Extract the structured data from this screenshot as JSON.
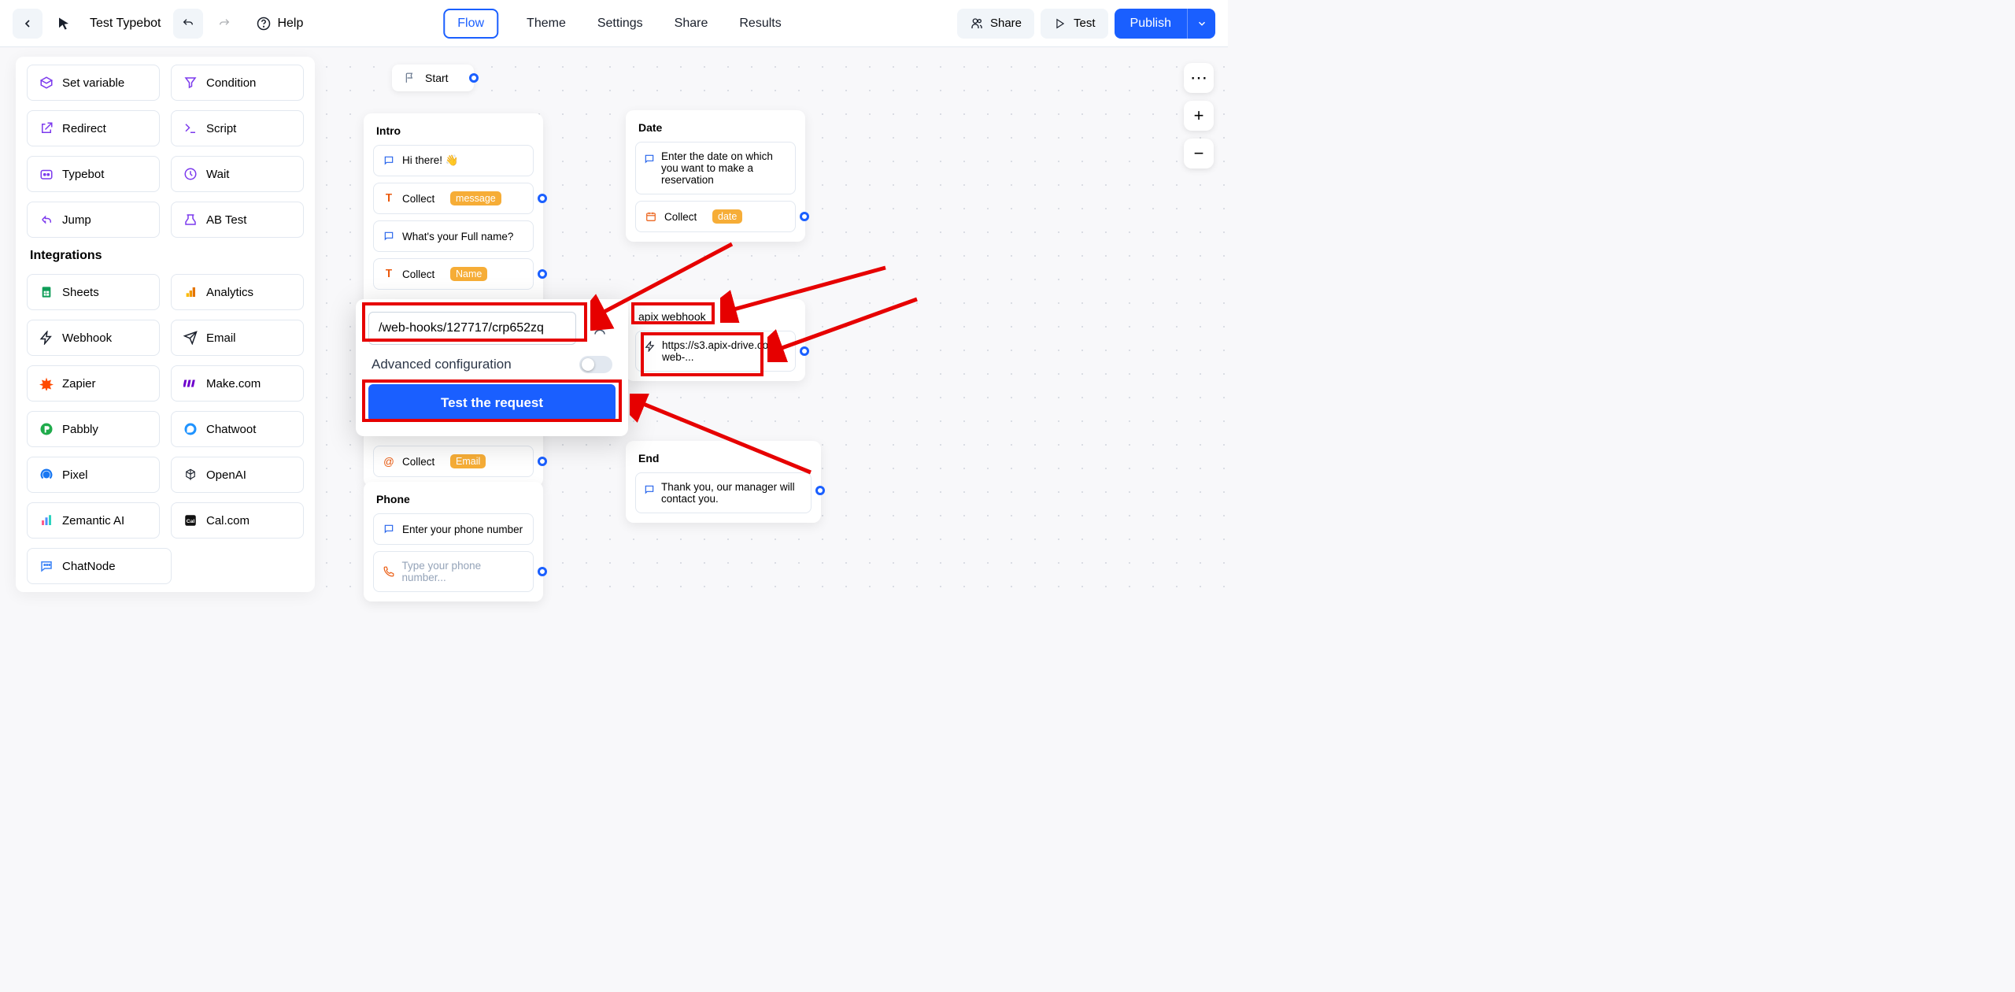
{
  "header": {
    "bot_name": "Test Typebot",
    "help": "Help",
    "tabs": {
      "flow": "Flow",
      "theme": "Theme",
      "settings": "Settings",
      "share": "Share",
      "results": "Results"
    },
    "share_btn": "Share",
    "test_btn": "Test",
    "publish_btn": "Publish"
  },
  "sidebar": {
    "logic": [
      {
        "icon": "box-icon",
        "label": "Set variable",
        "color": "#7c3aed"
      },
      {
        "icon": "filter-icon",
        "label": "Condition",
        "color": "#7c3aed"
      },
      {
        "icon": "redirect-icon",
        "label": "Redirect",
        "color": "#7c3aed"
      },
      {
        "icon": "script-icon",
        "label": "Script",
        "color": "#7c3aed"
      },
      {
        "icon": "typebot-icon",
        "label": "Typebot",
        "color": "#7c3aed"
      },
      {
        "icon": "wait-icon",
        "label": "Wait",
        "color": "#7c3aed"
      },
      {
        "icon": "jump-icon",
        "label": "Jump",
        "color": "#7c3aed"
      },
      {
        "icon": "abtest-icon",
        "label": "AB Test",
        "color": "#7c3aed"
      }
    ],
    "integrations_title": "Integrations",
    "integrations": [
      {
        "icon": "sheets-icon",
        "label": "Sheets"
      },
      {
        "icon": "analytics-icon",
        "label": "Analytics"
      },
      {
        "icon": "webhook-icon",
        "label": "Webhook"
      },
      {
        "icon": "email-icon",
        "label": "Email"
      },
      {
        "icon": "zapier-icon",
        "label": "Zapier"
      },
      {
        "icon": "make-icon",
        "label": "Make.com"
      },
      {
        "icon": "pabbly-icon",
        "label": "Pabbly"
      },
      {
        "icon": "chatwoot-icon",
        "label": "Chatwoot"
      },
      {
        "icon": "pixel-icon",
        "label": "Pixel"
      },
      {
        "icon": "openai-icon",
        "label": "OpenAI"
      },
      {
        "icon": "zemantic-icon",
        "label": "Zemantic AI"
      },
      {
        "icon": "calcom-icon",
        "label": "Cal.com"
      },
      {
        "icon": "chatnode-icon",
        "label": "ChatNode"
      }
    ]
  },
  "nodes": {
    "start": "Start",
    "intro": {
      "title": "Intro",
      "hi": "Hi there! 👋",
      "collect_prefix": "Collect",
      "msg_badge": "message",
      "fullname_q": "What's your Full name?",
      "name_badge": "Name",
      "email_badge": "Email"
    },
    "date": {
      "title": "Date",
      "enter_date": "Enter the date on which you want to make a reservation",
      "date_badge": "date"
    },
    "apix": {
      "title": "apix webhook",
      "url": "https://s3.apix-drive.com/web-..."
    },
    "end": {
      "title": "End",
      "thanks": "Thank you, our manager will contact you."
    },
    "phone": {
      "title": "Phone",
      "enter": "Enter your phone number",
      "placeholder": "Type your phone number..."
    }
  },
  "popover": {
    "url_value": "/web-hooks/127717/crp652zq",
    "advanced": "Advanced configuration",
    "test": "Test the request"
  }
}
